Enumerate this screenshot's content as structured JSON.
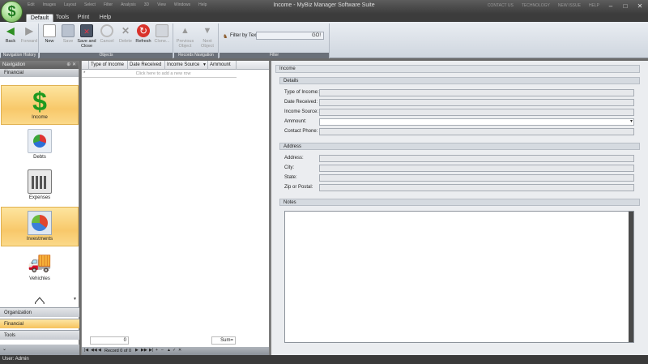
{
  "window": {
    "title": "Income - MyBiz Manager Software Suite",
    "app_logo_symbol": "$",
    "quick_access": [
      "Edit",
      "Images",
      "Layout",
      "Select",
      "Filter",
      "Analysis",
      "3D",
      "View",
      "Windows",
      "Help"
    ],
    "right_items": [
      "CONTACT US",
      "TECHNOLOGY",
      "NEW ISSUE",
      "HELP"
    ],
    "minimize": "–",
    "maximize": "□",
    "close": "✕"
  },
  "ribbon": {
    "tabs": [
      "Default",
      "Tools",
      "Print",
      "Help"
    ],
    "active_tab": "Default",
    "groups": {
      "navigation_history": "Navigation History",
      "objects": "Objects",
      "records_navigation": "Records Navigation",
      "filter": "Filter"
    },
    "buttons": {
      "back": "Back",
      "forward": "Forward",
      "new": "New",
      "save": "Save",
      "save_and_close": "Save and Close",
      "cancel": "Cancel",
      "delete": "Delete",
      "refresh": "Refresh",
      "clone": "Clone...",
      "previous_object": "Previous Object",
      "next_object": "Next Object"
    },
    "filter": {
      "label": "Filter by Text",
      "value": "",
      "go": "GO!"
    }
  },
  "navigation": {
    "header": "Navigation",
    "pin": "⊕ ✕",
    "section": "Financial",
    "items": [
      {
        "label": "Income",
        "icon": "dollar-icon",
        "active": true
      },
      {
        "label": "Debts",
        "icon": "debts-pie-chart-icon",
        "active": false
      },
      {
        "label": "Expenses",
        "icon": "calculator-icon",
        "active": false
      },
      {
        "label": "Investments",
        "icon": "investments-pie-chart-icon",
        "active": true
      },
      {
        "label": "Vehichles",
        "icon": "truck-icon",
        "active": false
      },
      {
        "label": "",
        "icon": "house-icon",
        "active": false
      }
    ],
    "groups": [
      {
        "label": "Organization",
        "active": false
      },
      {
        "label": "Financial",
        "active": true
      },
      {
        "label": "Tools",
        "active": false
      }
    ]
  },
  "grid": {
    "columns": [
      "Type of Income",
      "Date Received",
      "Income Source",
      "Ammount"
    ],
    "sort_indicator": "▼",
    "new_row_marker": "*",
    "new_row_text": "Click here to add a new row",
    "footer_count": "0",
    "footer_sum": "Sum=",
    "record_text": "Record 0 of 0"
  },
  "detail": {
    "title": "Income",
    "details_section": "Details",
    "fields": [
      {
        "label": "Type of Income:",
        "value": ""
      },
      {
        "label": "Date Received:",
        "value": ""
      },
      {
        "label": "Income Source:",
        "value": ""
      },
      {
        "label": "Ammount:",
        "value": ""
      },
      {
        "label": "Contact Phone:",
        "value": ""
      }
    ],
    "address_section": "Address",
    "address_fields": [
      {
        "label": "Address:",
        "value": ""
      },
      {
        "label": "City:",
        "value": ""
      },
      {
        "label": "State:",
        "value": ""
      },
      {
        "label": "Zip or Postal:",
        "value": ""
      }
    ],
    "notes_section": "Notes",
    "notes_value": ""
  },
  "status": {
    "user": "User: Admin"
  },
  "colors": {
    "accent_active": "#f8c86a",
    "title_bar": "#3c3c3c",
    "ribbon": "#dfe4ea",
    "income_icon": "#1f9a1f",
    "refresh_icon": "#d9322b"
  }
}
